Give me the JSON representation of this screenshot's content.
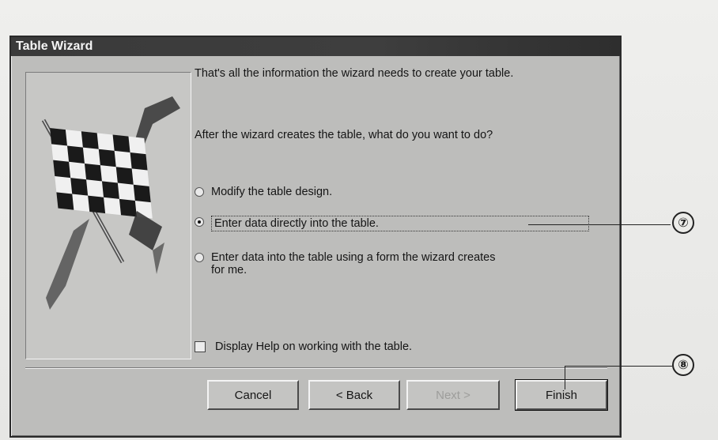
{
  "dialog": {
    "title": "Table Wizard",
    "message1": "That's all the information the wizard needs to create your table.",
    "message2": "After the wizard creates the table, what do you want to do?"
  },
  "options": [
    {
      "label": "Modify the table design.",
      "selected": false
    },
    {
      "label": "Enter data directly into the table.",
      "selected": true
    },
    {
      "label_line1": "Enter data into the table using a form the wizard creates",
      "label_line2": "for me.",
      "selected": false
    }
  ],
  "checkbox": {
    "label": "Display Help on working with the table.",
    "checked": false
  },
  "buttons": {
    "cancel": "Cancel",
    "back": "< Back",
    "next": "Next >",
    "finish": "Finish"
  },
  "callouts": {
    "seven": "⑦",
    "eight": "⑧"
  },
  "icons": {
    "picture": "checkered-flag-icon"
  }
}
